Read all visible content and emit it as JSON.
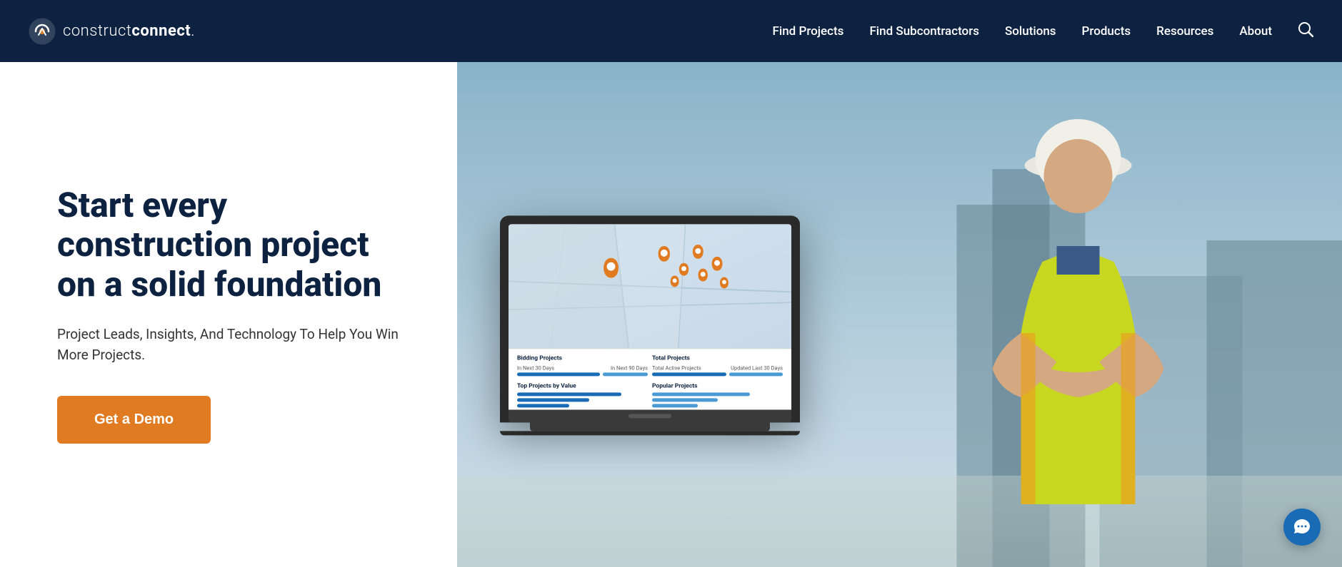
{
  "nav": {
    "logo_text_light": "construct",
    "logo_text_bold": "connect",
    "logo_trademark": ".",
    "links": [
      {
        "label": "Find Projects",
        "id": "find-projects"
      },
      {
        "label": "Find Subcontractors",
        "id": "find-subcontractors"
      },
      {
        "label": "Solutions",
        "id": "solutions"
      },
      {
        "label": "Products",
        "id": "products"
      },
      {
        "label": "Resources",
        "id": "resources"
      },
      {
        "label": "About",
        "id": "about"
      }
    ]
  },
  "hero": {
    "headline": "Start every construction project on a solid foundation",
    "subtext": "Project Leads, Insights, And Technology To Help You Win More Projects.",
    "cta_label": "Get a Demo"
  },
  "dashboard": {
    "section1_title": "Bidding Projects",
    "section2_title": "Total Projects",
    "section3_title": "Top Projects by Value",
    "section4_title": "Popular Projects"
  },
  "chat": {
    "label": "Chat support"
  }
}
